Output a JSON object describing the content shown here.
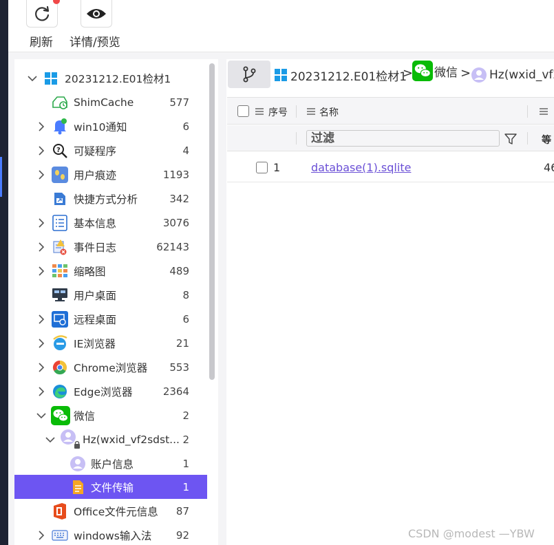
{
  "toolbar": {
    "refresh_label": "刷新",
    "detail_label": "详情/预览"
  },
  "tree": {
    "root": {
      "label": "20231212.E01检材1"
    },
    "items": [
      {
        "label": "ShimCache",
        "count": "577",
        "icon": "shimcache-icon"
      },
      {
        "label": "win10通知",
        "count": "6",
        "icon": "notification-bell-icon"
      },
      {
        "label": "可疑程序",
        "count": "4",
        "icon": "suspicious-search-icon"
      },
      {
        "label": "用户痕迹",
        "count": "1193",
        "icon": "user-traces-icon"
      },
      {
        "label": "快捷方式分析",
        "count": "342",
        "icon": "shortcut-icon"
      },
      {
        "label": "基本信息",
        "count": "3076",
        "icon": "basic-info-icon"
      },
      {
        "label": "事件日志",
        "count": "62143",
        "icon": "event-log-icon"
      },
      {
        "label": "缩略图",
        "count": "489",
        "icon": "thumbnail-icon"
      },
      {
        "label": "用户桌面",
        "count": "8",
        "icon": "desktop-monitor-icon"
      },
      {
        "label": "远程桌面",
        "count": "6",
        "icon": "remote-desktop-icon"
      },
      {
        "label": "IE浏览器",
        "count": "21",
        "icon": "ie-browser-icon"
      },
      {
        "label": "Chrome浏览器",
        "count": "553",
        "icon": "chrome-browser-icon"
      },
      {
        "label": "Edge浏览器",
        "count": "2364",
        "icon": "edge-browser-icon"
      },
      {
        "label": "微信",
        "count": "2",
        "icon": "wechat-icon"
      },
      {
        "label": "Hz(wxid_vf2sdst...",
        "count": "2",
        "icon": "user-avatar-locked-icon"
      },
      {
        "label": "账户信息",
        "count": "1",
        "icon": "user-avatar-icon"
      },
      {
        "label": "文件传输",
        "count": "1",
        "icon": "file-transfer-icon"
      },
      {
        "label": "Office文件元信息",
        "count": "87",
        "icon": "office-icon"
      },
      {
        "label": "windows输入法",
        "count": "92",
        "icon": "keyboard-icon"
      }
    ]
  },
  "breadcrumb": {
    "items": [
      {
        "label": "20231212.E01检材1",
        "icon": "windows-logo-icon"
      },
      {
        "label": "微信",
        "icon": "wechat-icon"
      },
      {
        "label": "Hz(wxid_vf2",
        "icon": "user-avatar-icon"
      }
    ],
    "separator": ">"
  },
  "table": {
    "columns": [
      {
        "label": "序号"
      },
      {
        "label": "名称"
      }
    ],
    "filter_placeholder": "过滤",
    "filter_next": "等",
    "rows": [
      {
        "index": "1",
        "name": "database(1).sqlite",
        "extra": "46"
      }
    ]
  },
  "watermark": "CSDN @modest —YBW",
  "colors": {
    "selection": "#6d55f2",
    "link": "#6a4fd6",
    "wechat": "#09bb07",
    "badge_red": "#f04848"
  }
}
